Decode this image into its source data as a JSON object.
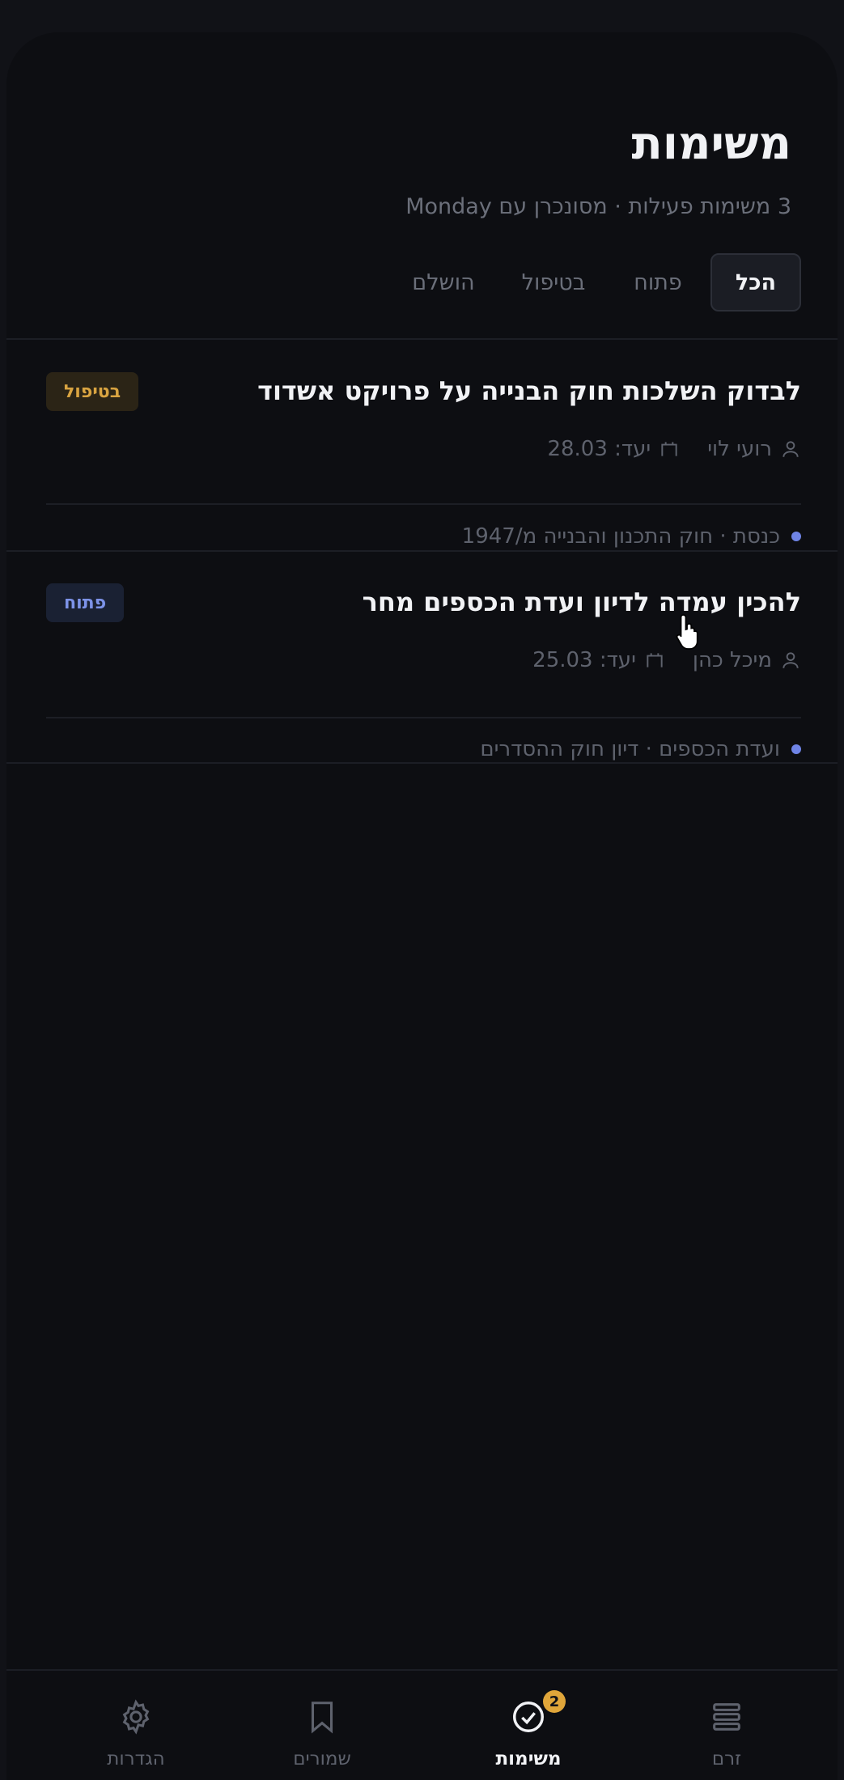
{
  "header": {
    "title": "משימות",
    "subtitle": "3 משימות פעילות · מסונכרן עם Monday"
  },
  "tabs": [
    {
      "label": "הכל",
      "active": true
    },
    {
      "label": "פתוח",
      "active": false
    },
    {
      "label": "בטיפול",
      "active": false
    },
    {
      "label": "הושלם",
      "active": false
    }
  ],
  "tasks": [
    {
      "title": "לבדוק השלכות חוק הבנייה על פרויקט אשדוד",
      "status": "בטיפול",
      "assignee": "רועי לוי",
      "due": "יעד: 28.03",
      "source": "כנסת · חוק התכנון והבנייה מ/1947"
    },
    {
      "title": "להכין עמדה לדיון ועדת הכספים מחר",
      "status": "פתוח",
      "assignee": "מיכל כהן",
      "due": "יעד: 25.03",
      "source": "ועדת הכספים · דיון חוק ההסדרים"
    }
  ],
  "nav": {
    "feed": "זרם",
    "tasks": "משימות",
    "tasks_badge": "2",
    "saved": "שמורים",
    "settings": "הגדרות"
  },
  "colors": {
    "background": "#0d0e12",
    "accent_blue": "#6f84e6",
    "status_progress": "#d9a441",
    "status_open": "#7d93e8",
    "nav_badge": "#e0a63a"
  }
}
